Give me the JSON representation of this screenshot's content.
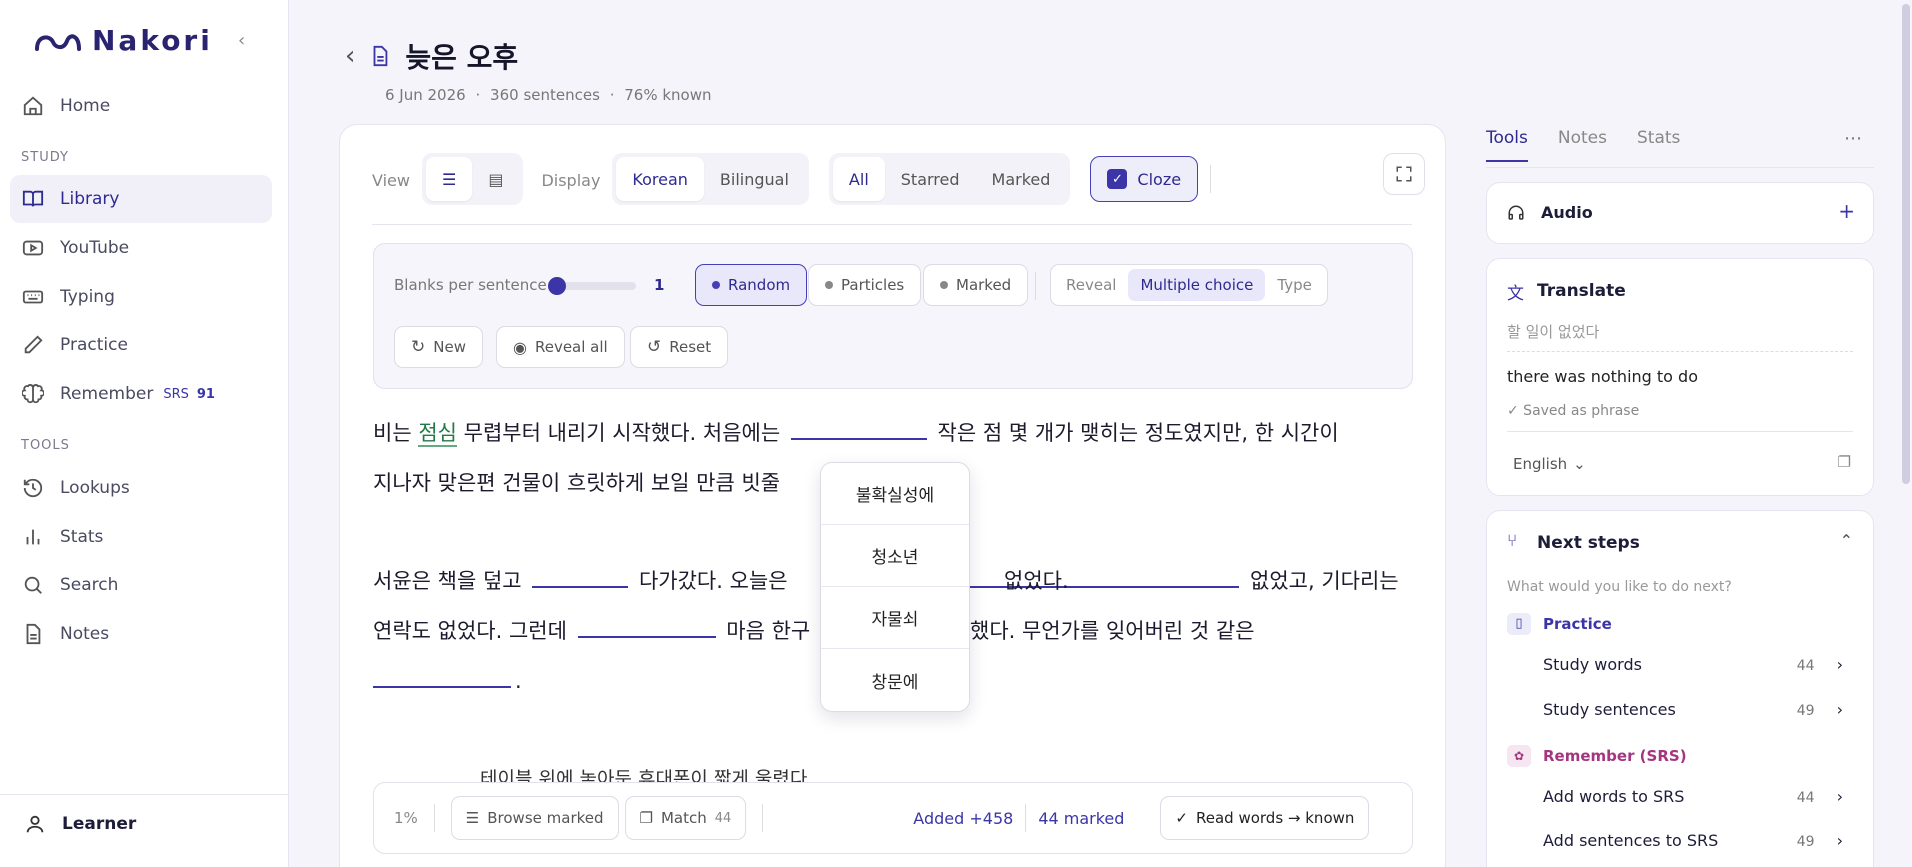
{
  "app": {
    "name": "Nakori"
  },
  "sidebar": {
    "home": "Home",
    "study_section": "STUDY",
    "items": [
      {
        "label": "Library"
      },
      {
        "label": "YouTube"
      },
      {
        "label": "Typing"
      },
      {
        "label": "Practice"
      },
      {
        "label": "Remember"
      }
    ],
    "srs_badge": "SRS",
    "srs_count": "91",
    "tools_section": "TOOLS",
    "tools": [
      {
        "label": "Lookups"
      },
      {
        "label": "Stats"
      },
      {
        "label": "Search"
      },
      {
        "label": "Notes"
      }
    ],
    "user": "Learner"
  },
  "doc": {
    "title": "늦은 오후",
    "date": "6 Jun 2026",
    "sentences": "360 sentences",
    "known": "76% known",
    "sep": "·"
  },
  "toolbar": {
    "view_label": "View",
    "display_label": "Display",
    "korean": "Korean",
    "bilingual": "Bilingual",
    "all": "All",
    "starred": "Starred",
    "marked": "Marked",
    "cloze": "Cloze"
  },
  "cloze_panel": {
    "blanks_label": "Blanks per sentence",
    "blanks_value": "1",
    "blanks_level": 0.0,
    "random": "Random",
    "particles": "Particles",
    "marked": "Marked",
    "reveal": "Reveal",
    "multiple_choice": "Multiple choice",
    "type": "Type",
    "new": "New",
    "reveal_all": "Reveal all",
    "reset": "Reset"
  },
  "text": {
    "p1a": "비는",
    "p1hl": "점심",
    "p1b": "무렵부터 내리기 시작했다. 처음에는",
    "p1c": "작은 점 몇 개가 맺히는 정도였지만, 한 시간이",
    "p2a": "지나자 맞은편 건물이 흐릿하게 보일 만큼 빗줄",
    "p3a": "서윤은 책을 덮고",
    "p3b": "다가갔다. 오늘은",
    "p3c": "없었다.",
    "p3d": "없었고, 기다리는",
    "p4a": "연락도 없었다. 그런데",
    "p4b": "마음 한구",
    "p4c": "했다. 무언가를 잊어버린 것 같은",
    "p5a": ".",
    "p6a": "테이블 위에 놓아둔 휴대폰이 짧게 울렸다."
  },
  "choices": [
    "불확실성에",
    "청소년",
    "자물쇠",
    "창문에"
  ],
  "bottom": {
    "percent": "1%",
    "browse": "Browse marked",
    "match": "Match",
    "match_count": "44",
    "added": "Added +458",
    "marked": "44 marked",
    "read_known": "Read words → known"
  },
  "right": {
    "tabs": [
      "Tools",
      "Notes",
      "Stats"
    ],
    "audio": "Audio",
    "translate": {
      "title": "Translate",
      "source": "할 일이 없었다",
      "result": "there was nothing to do",
      "saved": "✓ Saved as phrase",
      "lang": "English"
    },
    "next_steps": {
      "title": "Next steps",
      "subtitle": "What would you like to do next?",
      "practice": "Practice",
      "study_words": "Study words",
      "study_words_n": "44",
      "study_sentences": "Study sentences",
      "study_sentences_n": "49",
      "remember": "Remember (SRS)",
      "add_words": "Add words to SRS",
      "add_words_n": "44",
      "add_sentences": "Add sentences to SRS",
      "add_sentences_n": "49"
    }
  }
}
